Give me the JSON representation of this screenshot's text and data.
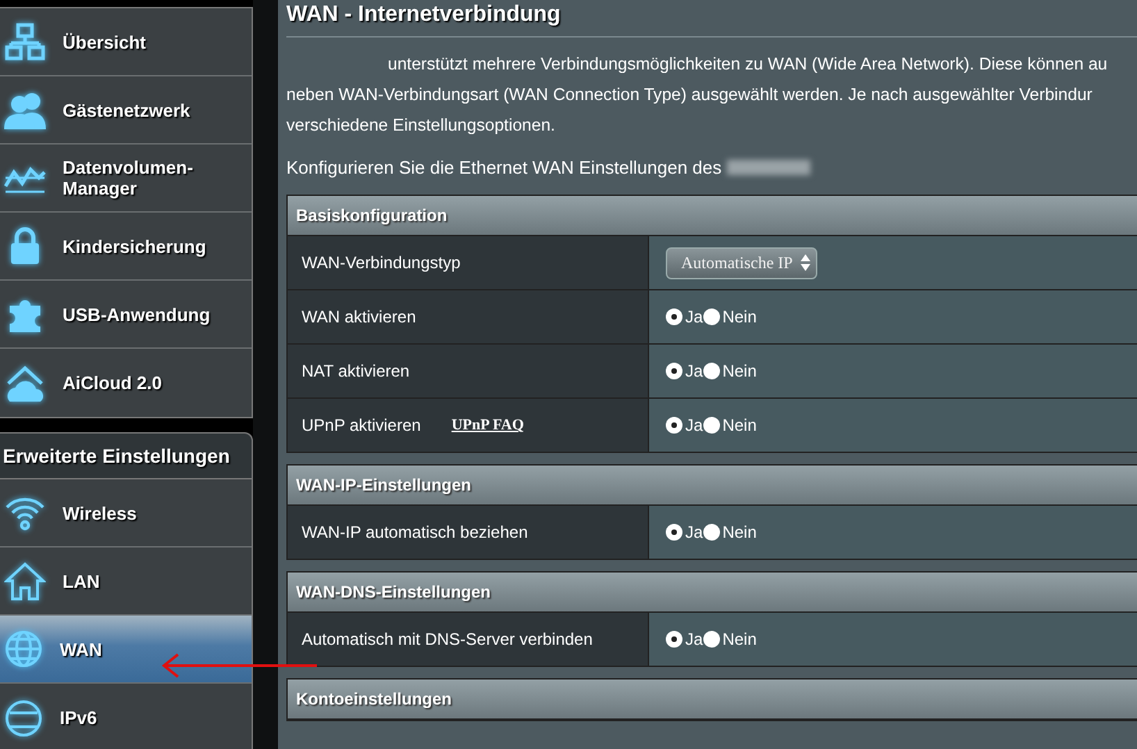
{
  "sidebar": {
    "general_items": [
      {
        "label": "Übersicht",
        "selected": false
      },
      {
        "label": "Gästenetzwerk",
        "selected": false
      },
      {
        "label": "Datenvolumen-Manager",
        "selected": false
      },
      {
        "label": "Kindersicherung",
        "selected": false
      },
      {
        "label": "USB-Anwendung",
        "selected": false
      },
      {
        "label": "AiCloud 2.0",
        "selected": false
      }
    ],
    "advanced_header": "Erweiterte Einstellungen",
    "advanced_items": [
      {
        "label": "Wireless",
        "selected": false
      },
      {
        "label": "LAN",
        "selected": false
      },
      {
        "label": "WAN",
        "selected": true
      },
      {
        "label": "IPv6",
        "selected": false
      }
    ]
  },
  "page": {
    "title": "WAN - Internetverbindung",
    "intro_lines": [
      "unterstützt mehrere Verbindungsmöglichkeiten zu WAN (Wide Area Network). Diese können au",
      "neben WAN-Verbindungsart (WAN Connection Type) ausgewählt werden. Je nach ausgewählter Verbindur",
      "verschiedene Einstellungsoptionen."
    ],
    "configure_text": "Konfigurieren Sie die Ethernet WAN Einstellungen des"
  },
  "sections": [
    {
      "title": "Basiskonfiguration",
      "rows": [
        {
          "kind": "select",
          "label": "WAN-Verbindungstyp",
          "value": "Automatische IP"
        },
        {
          "kind": "radio",
          "label": "WAN aktivieren",
          "options": [
            {
              "label": "Ja",
              "selected": true
            },
            {
              "label": "Nein",
              "selected": false
            }
          ]
        },
        {
          "kind": "radio",
          "label": "NAT aktivieren",
          "options": [
            {
              "label": "Ja",
              "selected": true
            },
            {
              "label": "Nein",
              "selected": false
            }
          ]
        },
        {
          "kind": "radio",
          "label": "UPnP aktivieren",
          "link": "UPnP FAQ",
          "options": [
            {
              "label": "Ja",
              "selected": true
            },
            {
              "label": "Nein",
              "selected": false
            }
          ]
        }
      ]
    },
    {
      "title": "WAN-IP-Einstellungen",
      "rows": [
        {
          "kind": "radio",
          "label": "WAN-IP automatisch beziehen",
          "options": [
            {
              "label": "Ja",
              "selected": true
            },
            {
              "label": "Nein",
              "selected": false
            }
          ]
        }
      ]
    },
    {
      "title": "WAN-DNS-Einstellungen",
      "rows": [
        {
          "kind": "radio",
          "label": "Automatisch mit DNS-Server verbinden",
          "options": [
            {
              "label": "Ja",
              "selected": true
            },
            {
              "label": "Nein",
              "selected": false
            }
          ]
        }
      ]
    },
    {
      "title": "Kontoeinstellungen"
    }
  ]
}
